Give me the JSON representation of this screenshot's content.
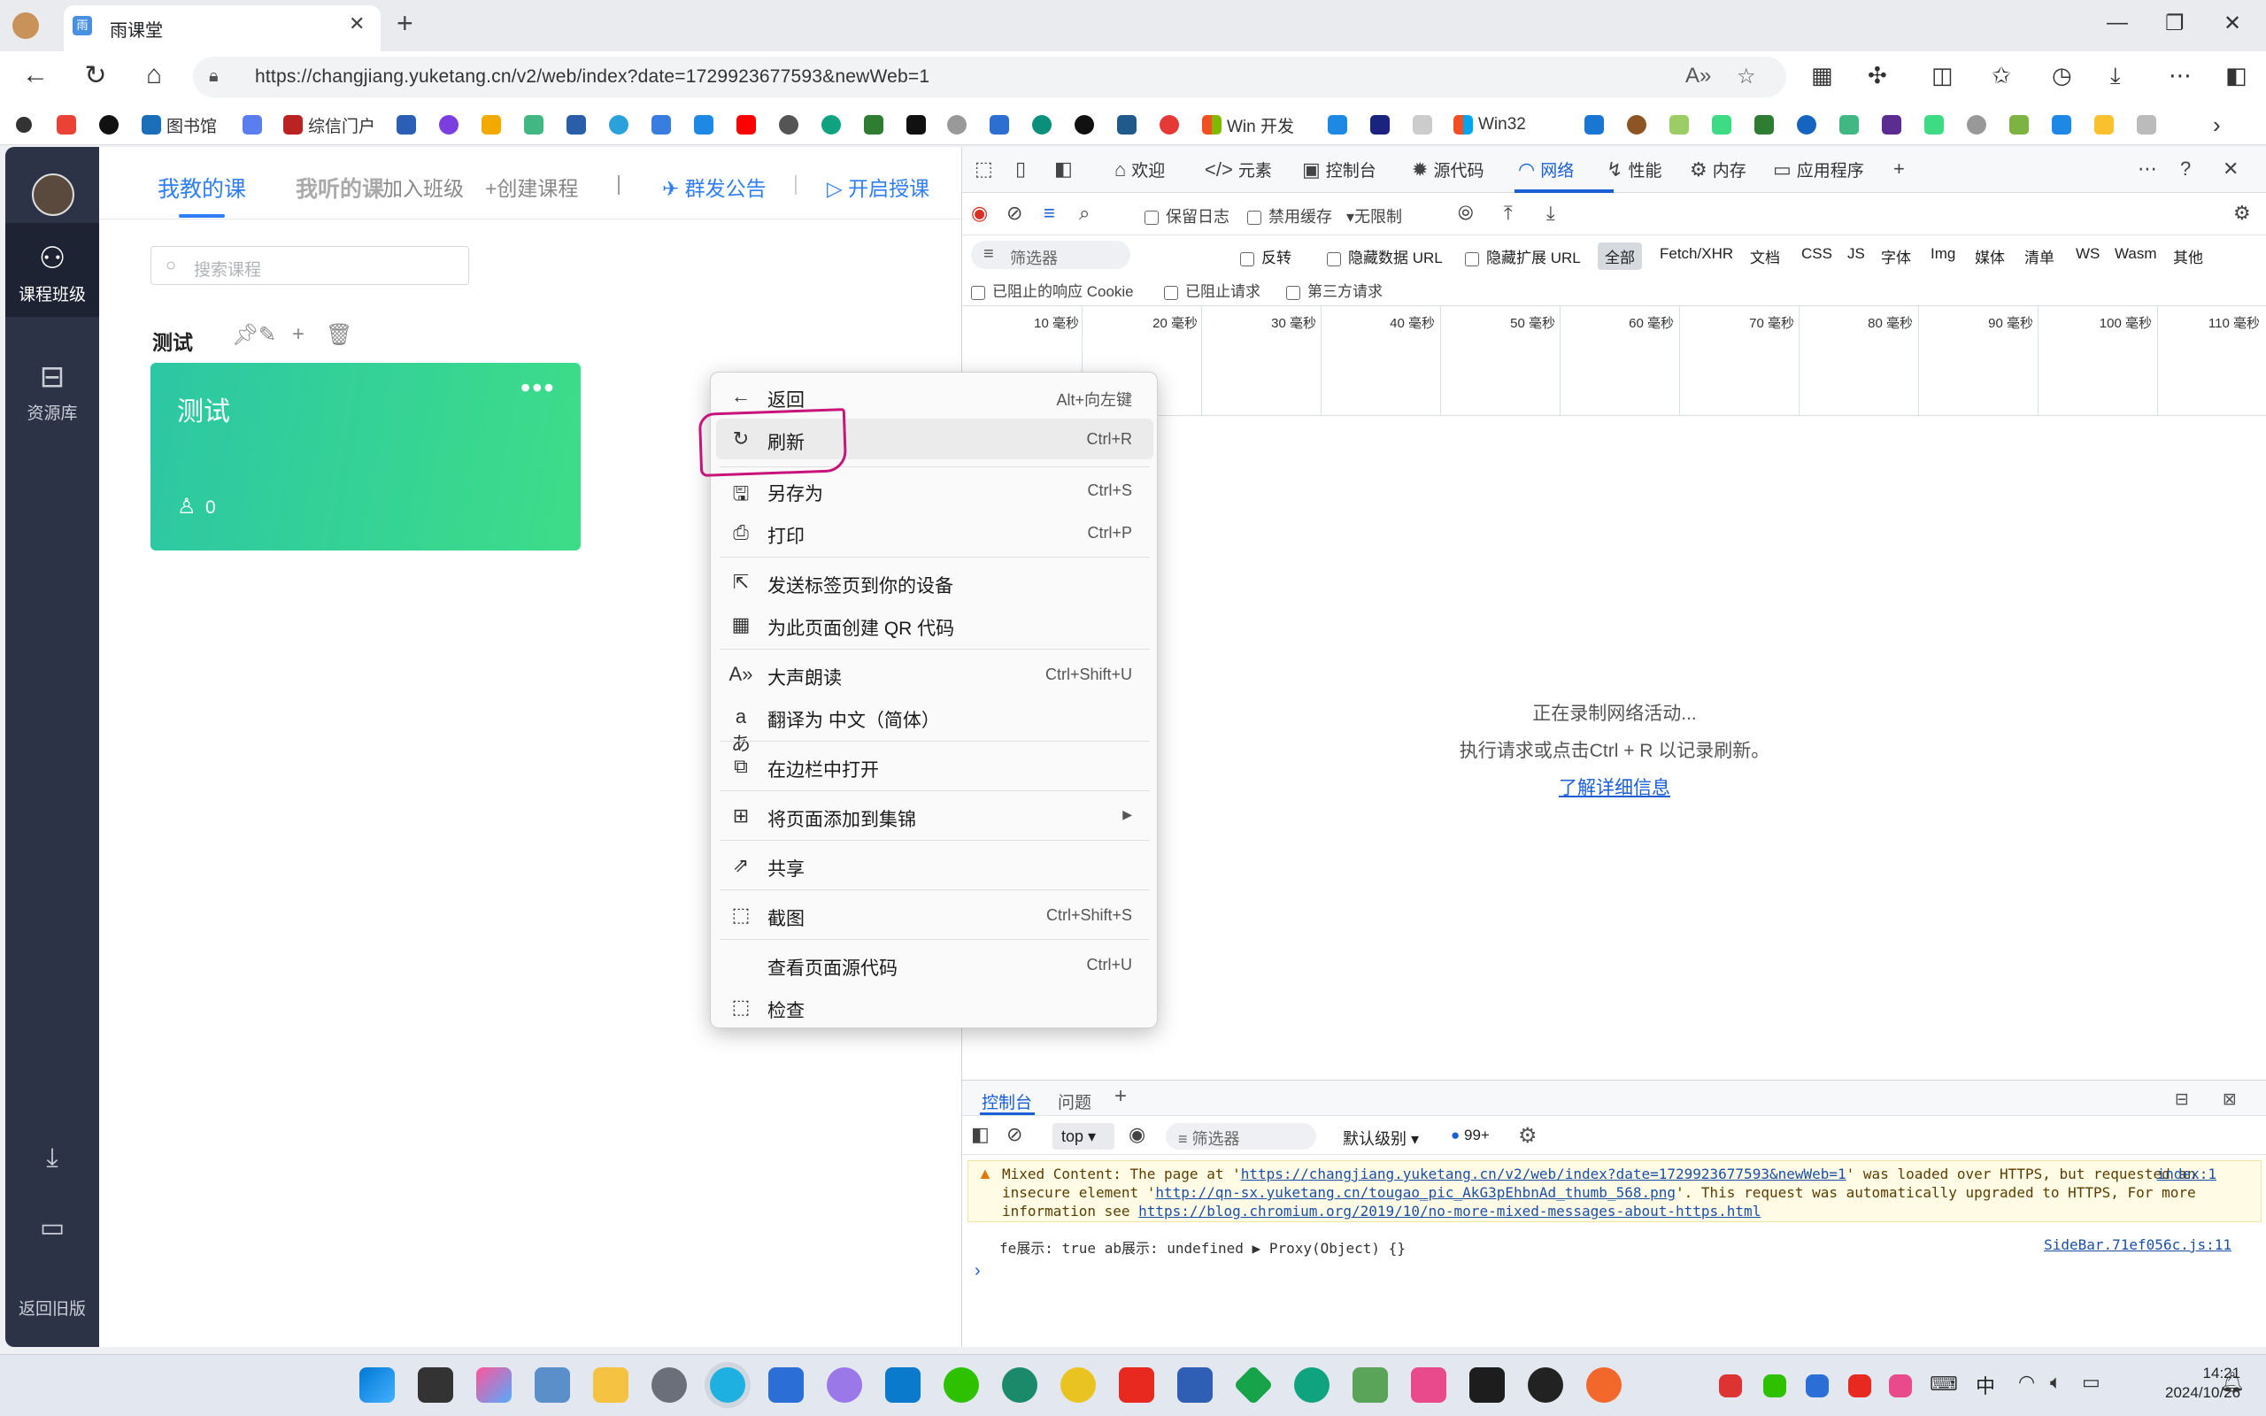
{
  "browser": {
    "tab_title": "雨课堂",
    "url": "https://changjiang.yuketang.cn/v2/web/index?date=1729923677593&newWeb=1",
    "bookmarks": [
      "图书馆",
      "综信门户",
      "Win 开发",
      "Win32"
    ]
  },
  "app_nav": {
    "items": [
      {
        "label": "课程班级",
        "icon": "course-class-icon"
      },
      {
        "label": "资源库",
        "icon": "resource-library-icon"
      }
    ],
    "back_old": "返回旧版"
  },
  "main": {
    "tabs": {
      "teach": "我教的课",
      "listen": "我听的课",
      "join": "加入班级",
      "create": "+创建课程",
      "divider": "|",
      "group_notice": "群发公告",
      "start_class": "开启授课"
    },
    "search_placeholder": "搜索课程",
    "group_title": "测试",
    "card": {
      "title": "测试",
      "more": "•••",
      "students": "0"
    }
  },
  "context_menu": {
    "items": [
      {
        "label": "返回",
        "shortcut": "Alt+向左键",
        "icon": "back-arrow-icon"
      },
      {
        "label": "刷新",
        "shortcut": "Ctrl+R",
        "icon": "refresh-icon"
      },
      {
        "label": "另存为",
        "shortcut": "Ctrl+S",
        "icon": "save-as-icon"
      },
      {
        "label": "打印",
        "shortcut": "Ctrl+P",
        "icon": "print-icon"
      },
      {
        "label": "发送标签页到你的设备",
        "shortcut": "",
        "icon": "send-to-device-icon"
      },
      {
        "label": "为此页面创建 QR 代码",
        "shortcut": "",
        "icon": "qr-code-icon"
      },
      {
        "label": "大声朗读",
        "shortcut": "Ctrl+Shift+U",
        "icon": "read-aloud-icon"
      },
      {
        "label": "翻译为 中文（简体）",
        "shortcut": "",
        "icon": "translate-icon"
      },
      {
        "label": "在边栏中打开",
        "shortcut": "",
        "icon": "sidebar-open-icon"
      },
      {
        "label": "将页面添加到集锦",
        "shortcut": "",
        "icon": "collections-icon"
      },
      {
        "label": "共享",
        "shortcut": "",
        "icon": "share-icon"
      },
      {
        "label": "截图",
        "shortcut": "Ctrl+Shift+S",
        "icon": "screenshot-icon"
      },
      {
        "label": "查看页面源代码",
        "shortcut": "Ctrl+U",
        "icon": ""
      },
      {
        "label": "检查",
        "shortcut": "",
        "icon": "inspect-icon"
      }
    ]
  },
  "devtools": {
    "tabs": [
      "欢迎",
      "元素",
      "控制台",
      "源代码",
      "网络",
      "性能",
      "内存",
      "应用程序"
    ],
    "toolbar": {
      "preserve_log": "保留日志",
      "disable_cache": "禁用缓存",
      "throttling": "无限制"
    },
    "filter": {
      "placeholder": "筛选器",
      "invert": "反转",
      "hide_data_urls": "隐藏数据 URL",
      "hide_ext_urls": "隐藏扩展 URL",
      "types": [
        "全部",
        "Fetch/XHR",
        "文档",
        "CSS",
        "JS",
        "字体",
        "Img",
        "媒体",
        "清单",
        "WS",
        "Wasm",
        "其他"
      ]
    },
    "filter2": {
      "blocked_cookies": "已阻止的响应 Cookie",
      "blocked_requests": "已阻止请求",
      "third_party": "第三方请求"
    },
    "timeline_ticks": [
      "10 毫秒",
      "20 毫秒",
      "30 毫秒",
      "40 毫秒",
      "50 毫秒",
      "60 毫秒",
      "70 毫秒",
      "80 毫秒",
      "90 毫秒",
      "100 毫秒",
      "110 毫秒"
    ],
    "recording": {
      "line1": "正在录制网络活动...",
      "line2": "执行请求或点击Ctrl + R 以记录刷新。",
      "learn_more": "了解详细信息"
    },
    "console": {
      "tabs": [
        "控制台",
        "问题"
      ],
      "context": "top",
      "filter": "筛选器",
      "level": "默认级别",
      "badge": "99+",
      "warning": {
        "p1": "Mixed Content: The page at '",
        "url1": "https://changjiang.yuketang.cn/v2/web/index?date=1729923677593&newWeb=1",
        "p2": "' was loaded over HTTPS, but requested an insecure element '",
        "url2": "http://qn-sx.yuketang.cn/tougao_pic_AkG3pEhbnAd_thumb_568.png",
        "p3": "'. This request was automatically upgraded to HTTPS, For more information see ",
        "url3": "https://blog.chromium.org/2019/10/no-more-mixed-messages-about-https.html",
        "source": "index:1"
      },
      "log": {
        "text": "fe展示:  true  ab展示: undefined  ▶ Proxy(Object) {}",
        "source": "SideBar.71ef056c.js:11"
      }
    }
  },
  "taskbar": {
    "time": "14:21",
    "date": "2024/10/26",
    "ime": "中"
  }
}
